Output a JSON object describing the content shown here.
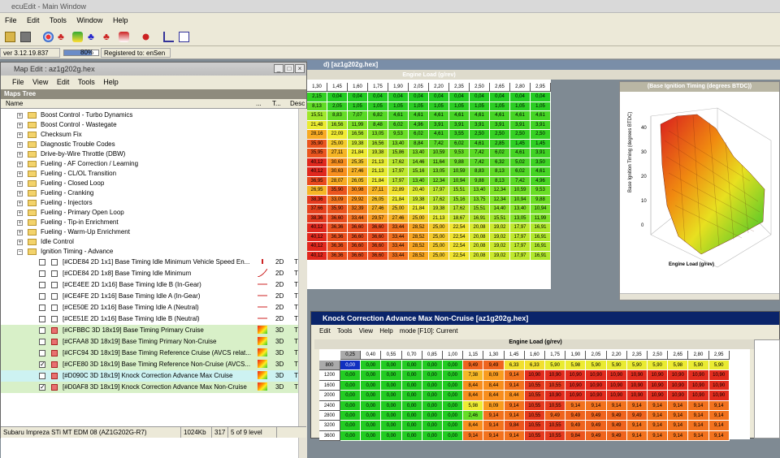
{
  "main_window": {
    "title": "ecuEdit - Main Window",
    "menu": [
      "File",
      "Edit",
      "Tools",
      "Window",
      "Help"
    ]
  },
  "status": {
    "version": "ver 3.12.19.837",
    "progress_percent": 80,
    "progress_text": "80%",
    "registered": "Registered to: enSen"
  },
  "map_edit": {
    "title": "Map Edit : az1g202g.hex",
    "menu": [
      "File",
      "View",
      "Edit",
      "Tools",
      "Help"
    ],
    "tree_label": "Maps Tree",
    "col_name": "Name",
    "col_dots": "...",
    "col_t": "T...",
    "col_desc": "Desc",
    "folders": [
      "Boost Control - Turbo Dynamics",
      "Boost Control - Wastegate",
      "Checksum Fix",
      "Diagnostic Trouble Codes",
      "Drive-by-Wire Throttle (DBW)",
      "Fueling - AF Correction / Learning",
      "Fueling - CL/OL Transition",
      "Fueling - Closed Loop",
      "Fueling - Cranking",
      "Fueling - Injectors",
      "Fueling - Primary Open Loop",
      "Fueling - Tip-in Enrichment",
      "Fueling - Warm-Up Enrichment",
      "Idle Control"
    ],
    "open_folder": "Ignition Timing - Advance",
    "maps": [
      {
        "label": "[#CDE84 2D 1x1] Base Timing Idle Minimum Vehicle Speed En...",
        "dim": "2D",
        "type": "T",
        "checked": false,
        "highlight": false
      },
      {
        "label": "[#CDE84 2D 1x8] Base Timing Idle Minimum",
        "dim": "2D",
        "type": "T",
        "checked": false,
        "highlight": false
      },
      {
        "label": "[#CE4EE 2D 1x16] Base Timing Idle B (In-Gear)",
        "dim": "2D",
        "type": "T",
        "checked": false,
        "highlight": false
      },
      {
        "label": "[#CE4FE 2D 1x16] Base Timing Idle A (In-Gear)",
        "dim": "2D",
        "type": "T",
        "checked": false,
        "highlight": false
      },
      {
        "label": "[#CE50E 2D 1x16] Base Timing Idle A (Neutral)",
        "dim": "2D",
        "type": "T",
        "checked": false,
        "highlight": false
      },
      {
        "label": "[#CE51E 2D 1x16] Base Timing Idle B (Neutral)",
        "dim": "2D",
        "type": "T",
        "checked": false,
        "highlight": false
      },
      {
        "label": "[#CFBBC 3D 18x19] Base Timing Primary Cruise",
        "dim": "3D",
        "type": "T",
        "checked": false,
        "highlight": false
      },
      {
        "label": "[#CFAA8 3D 18x19] Base Timing Primary Non-Cruise",
        "dim": "3D",
        "type": "T",
        "checked": false,
        "highlight": false
      },
      {
        "label": "[#CFC94 3D 18x19] Base Timing Reference Cruise (AVCS relat...",
        "dim": "3D",
        "type": "T",
        "checked": false,
        "highlight": false
      },
      {
        "label": "[#CFE80 3D 18x19] Base Timing Reference Non-Cruise (AVCS...",
        "dim": "3D",
        "type": "T",
        "checked": true,
        "highlight": false
      },
      {
        "label": "[#D090C 3D 18x19] Knock Correction Advance Max Cruise",
        "dim": "3D",
        "type": "T",
        "checked": false,
        "highlight": true
      },
      {
        "label": "[#D0AF8 3D 18x19] Knock Correction Advance Max Non-Cruise",
        "dim": "3D",
        "type": "T",
        "checked": true,
        "highlight": false
      }
    ],
    "status_rom": "Subaru Impreza STi MT EDM 08 (AZ1G202G-R7)",
    "status_size": "1024Kb",
    "status_count": "317",
    "status_level": "5 of 9 level"
  },
  "base_table": {
    "title_fragment": "d) [az1g202g.hex]",
    "axis_label": "Engine Load (g/rev)",
    "load_cols": [
      "1,30",
      "1,45",
      "1,60",
      "1,75",
      "1,90",
      "2,05",
      "2,20",
      "2,35",
      "2,50",
      "2,65",
      "2,80",
      "2,95"
    ],
    "rows": [
      [
        "2,15",
        "0,04",
        "0,04",
        "0,04",
        "0,04",
        "0,04",
        "0,04",
        "0,04",
        "0,04",
        "0,04",
        "0,04",
        "0,04"
      ],
      [
        "8,13",
        "2,05",
        "1,05",
        "1,05",
        "1,05",
        "1,05",
        "1,05",
        "1,05",
        "1,05",
        "1,05",
        "1,05",
        "1,05"
      ],
      [
        "15,51",
        "8,83",
        "7,07",
        "6,82",
        "4,61",
        "4,61",
        "4,61",
        "4,61",
        "4,61",
        "4,61",
        "4,61",
        "4,61"
      ],
      [
        "21,48",
        "16,56",
        "11,99",
        "8,48",
        "6,02",
        "4,96",
        "3,91",
        "3,91",
        "3,91",
        "3,91",
        "3,91",
        "3,91"
      ],
      [
        "28,16",
        "22,09",
        "16,56",
        "13,05",
        "9,53",
        "6,02",
        "4,61",
        "3,55",
        "2,50",
        "2,50",
        "2,50",
        "2,50"
      ],
      [
        "35,90",
        "25,00",
        "19,38",
        "16,56",
        "13,40",
        "8,84",
        "7,42",
        "6,02",
        "4,61",
        "2,85",
        "1,45",
        "1,45"
      ],
      [
        "35,95",
        "27,11",
        "21,84",
        "19,38",
        "15,86",
        "13,40",
        "10,59",
        "9,53",
        "7,42",
        "6,02",
        "4,61",
        "3,91"
      ],
      [
        "40,12",
        "30,63",
        "25,35",
        "21,13",
        "17,62",
        "14,46",
        "11,64",
        "9,88",
        "7,42",
        "6,32",
        "5,02",
        "3,50"
      ],
      [
        "40,12",
        "30,63",
        "27,46",
        "21,13",
        "17,97",
        "15,16",
        "13,05",
        "10,59",
        "8,83",
        "8,13",
        "6,02",
        "4,61"
      ],
      [
        "36,95",
        "28,07",
        "26,05",
        "21,84",
        "17,97",
        "13,40",
        "12,34",
        "10,94",
        "9,88",
        "8,13",
        "7,42",
        "4,96"
      ],
      [
        "26,95",
        "35,90",
        "30,98",
        "27,11",
        "22,89",
        "20,40",
        "17,97",
        "15,51",
        "13,40",
        "12,34",
        "10,59",
        "9,53"
      ],
      [
        "38,36",
        "33,09",
        "29,92",
        "26,05",
        "21,84",
        "19,38",
        "17,62",
        "15,16",
        "13,75",
        "12,34",
        "10,94",
        "9,88"
      ],
      [
        "37,66",
        "35,90",
        "32,39",
        "27,46",
        "25,00",
        "21,84",
        "19,38",
        "17,62",
        "15,51",
        "14,40",
        "13,40",
        "10,94"
      ],
      [
        "38,36",
        "36,60",
        "33,44",
        "29,57",
        "27,46",
        "25,00",
        "21,13",
        "18,67",
        "16,91",
        "15,51",
        "13,05",
        "11,99"
      ],
      [
        "40,12",
        "36,36",
        "36,60",
        "36,60",
        "33,44",
        "28,52",
        "25,00",
        "22,54",
        "20,08",
        "19,02",
        "17,97",
        "16,91"
      ],
      [
        "40,12",
        "36,36",
        "36,60",
        "36,60",
        "33,44",
        "28,52",
        "25,00",
        "22,54",
        "20,08",
        "19,02",
        "17,97",
        "16,91"
      ],
      [
        "40,12",
        "36,36",
        "36,60",
        "36,60",
        "33,44",
        "28,52",
        "25,00",
        "22,54",
        "20,08",
        "19,02",
        "17,97",
        "16,91"
      ],
      [
        "40,12",
        "36,36",
        "36,60",
        "36,60",
        "33,44",
        "28,52",
        "25,00",
        "22,54",
        "20,08",
        "19,02",
        "17,97",
        "16,91"
      ]
    ]
  },
  "chart": {
    "title": "(Base Ignition Timing (degrees BTDC))",
    "z_axis_label": "Base Ignition Timing (degrees BTDC)",
    "x_axis_label": "Engine Load (g/rev)",
    "z_ticks": [
      "40",
      "30",
      "20",
      "10",
      "0"
    ]
  },
  "knock": {
    "title": "Knock Correction Advance Max Non-Cruise [az1g202g.hex]",
    "menu": [
      "Edit",
      "Tools",
      "View",
      "Help"
    ],
    "mode": "mode [F10]: Current",
    "axis_label": "Engine Load (g/rev)",
    "load_cols": [
      "0,25",
      "0,40",
      "0,55",
      "0,70",
      "0,85",
      "1,00",
      "1,15",
      "1,30",
      "1,45",
      "1,60",
      "1,75",
      "1,90",
      "2,05",
      "2,20",
      "2,35",
      "2,50",
      "2,65",
      "2,80",
      "2,95"
    ],
    "rpm_rows": [
      "800",
      "1200",
      "1600",
      "2000",
      "2400",
      "2800",
      "3200",
      "3600"
    ],
    "rows": [
      [
        "0,00",
        "0,00",
        "0,00",
        "0,00",
        "0,00",
        "0,00",
        "9,49",
        "9,49",
        "6,33",
        "6,33",
        "5,90",
        "5,98",
        "5,90",
        "5,90",
        "5,90",
        "5,90",
        "5,98",
        "5,90",
        "5,90"
      ],
      [
        "0,00",
        "0,00",
        "0,00",
        "0,00",
        "0,00",
        "0,00",
        "7,38",
        "8,09",
        "9,14",
        "10,90",
        "10,90",
        "10,90",
        "10,90",
        "10,90",
        "10,90",
        "10,90",
        "10,90",
        "10,90",
        "10,90"
      ],
      [
        "0,00",
        "0,00",
        "0,00",
        "0,00",
        "0,00",
        "0,00",
        "8,44",
        "8,44",
        "9,14",
        "10,55",
        "10,55",
        "10,90",
        "10,90",
        "10,90",
        "10,90",
        "10,90",
        "10,90",
        "10,90",
        "10,90"
      ],
      [
        "0,00",
        "0,00",
        "0,00",
        "0,00",
        "0,00",
        "0,00",
        "8,44",
        "8,44",
        "8,44",
        "10,55",
        "10,90",
        "10,90",
        "10,90",
        "10,90",
        "10,90",
        "10,90",
        "10,90",
        "10,90",
        "10,90"
      ],
      [
        "0,00",
        "0,00",
        "0,00",
        "0,00",
        "0,00",
        "0,00",
        "5,98",
        "8,09",
        "9,14",
        "10,55",
        "10,55",
        "9,14",
        "9,14",
        "9,14",
        "9,14",
        "9,14",
        "9,14",
        "9,14",
        "9,14"
      ],
      [
        "0,00",
        "0,00",
        "0,00",
        "0,00",
        "0,00",
        "0,00",
        "2,46",
        "9,14",
        "9,14",
        "10,55",
        "9,49",
        "9,49",
        "9,49",
        "9,49",
        "9,49",
        "9,14",
        "9,14",
        "9,14",
        "9,14"
      ],
      [
        "0,00",
        "0,00",
        "0,00",
        "0,00",
        "0,00",
        "0,00",
        "8,44",
        "9,14",
        "9,84",
        "10,55",
        "10,55",
        "9,49",
        "9,49",
        "9,49",
        "9,14",
        "9,14",
        "9,14",
        "9,14",
        "9,14"
      ],
      [
        "0,00",
        "0,00",
        "0,00",
        "0,00",
        "0,00",
        "0,00",
        "9,14",
        "9,14",
        "9,14",
        "10,55",
        "10,55",
        "9,84",
        "9,49",
        "9,49",
        "9,14",
        "9,14",
        "9,14",
        "9,14",
        "9,14"
      ]
    ]
  },
  "colors": {
    "window_bg": "#ece9d8",
    "title_active": "#0a246a",
    "desktop": "#7f8a93",
    "highlight_row": "#cdf2f2",
    "selected_row": "#d8f0c8"
  }
}
